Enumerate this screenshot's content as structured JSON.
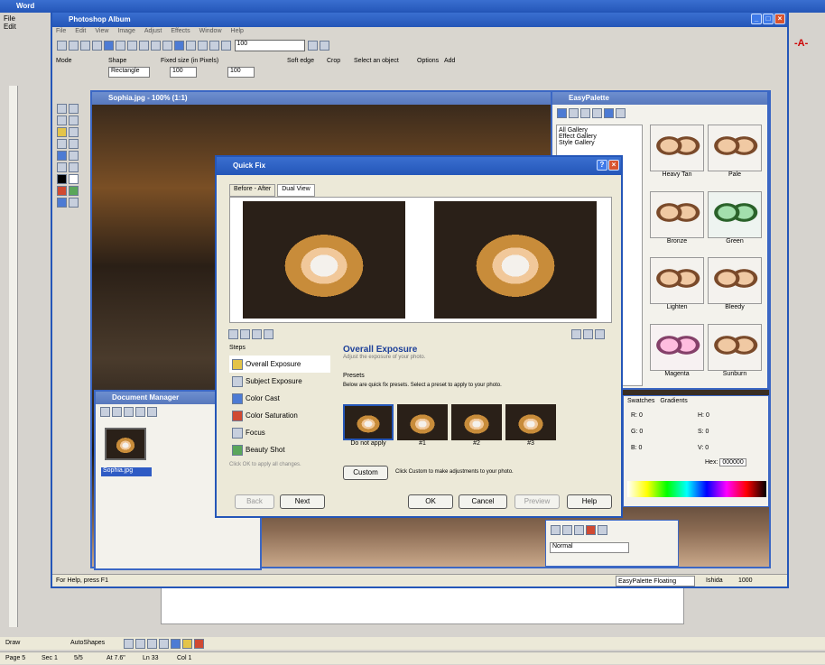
{
  "outer_window": {
    "title": "Word",
    "menu": [
      "File",
      "Edit"
    ]
  },
  "app": {
    "title": "Photoshop Album",
    "menu": [
      "File",
      "Edit",
      "View",
      "Image",
      "Adjust",
      "Effects",
      "Window",
      "Help"
    ],
    "zoom_value": "100",
    "options_labels": [
      "Mode",
      "Shape",
      "Fixed size (in Pixels)",
      "Soft edge",
      "Crop",
      "Select an object",
      "Options",
      "Add"
    ],
    "options_shape_value": "Rectangle",
    "options_width_value": "100",
    "options_height_value": "100",
    "status_bar_left": "For Help, press F1",
    "status_bar_palette": "EasyPalette Floating",
    "status_bar_zoom": "Ishida",
    "status_bar_count": "1000"
  },
  "image_window": {
    "title": "Sophia.jpg - 100% (1:1)"
  },
  "easy_palette": {
    "title": "EasyPalette",
    "tree": [
      "All Gallery",
      "Effect Gallery",
      "Style Gallery"
    ],
    "items": [
      "Heavy Tan",
      "Pale",
      "Bronze",
      "Green",
      "Lighten",
      "Bleedy",
      "Magenta",
      "Sunburn"
    ]
  },
  "filmstrip": {
    "title": "Document Manager",
    "thumb_label": "Sophia.jpg"
  },
  "swatches": {
    "tabs": [
      "Swatches",
      "Gradients"
    ],
    "hex_label": "Hex:",
    "hex_value": "000000",
    "rgb_fields": [
      "R: 0",
      "G: 0",
      "B: 0",
      "H: 0",
      "S: 0",
      "V: 0"
    ]
  },
  "layers_panel": {
    "blend_mode": "Normal"
  },
  "dialog": {
    "title": "Quick Fix",
    "tabs": [
      "Before - After",
      "Dual View"
    ],
    "steps_heading": "Steps",
    "steps": [
      "Overall Exposure",
      "Subject Exposure",
      "Color Cast",
      "Color Saturation",
      "Focus",
      "Beauty Shot"
    ],
    "steps_hint": "Click OK to apply all changes.",
    "section_title": "Overall Exposure",
    "section_desc": "Adjust the exposure of your photo.",
    "presets_heading": "Presets",
    "presets_desc": "Below are quick fix presets. Select a preset to apply to your photo.",
    "presets": [
      "Do not apply",
      "#1",
      "#2",
      "#3"
    ],
    "custom_button": "Custom",
    "custom_desc": "Click Custom to make adjustments to your photo.",
    "back_button": "Back",
    "next_button": "Next",
    "ok_button": "OK",
    "cancel_button": "Cancel",
    "preview_button": "Preview",
    "help_button": "Help"
  },
  "word_status": {
    "draw_label": "Draw",
    "autoshapes_label": "AutoShapes",
    "page": "Page 5",
    "sec": "Sec 1",
    "pages": "5/5",
    "at": "At 7.6\"",
    "ln": "Ln 33",
    "col": "Col 1"
  }
}
